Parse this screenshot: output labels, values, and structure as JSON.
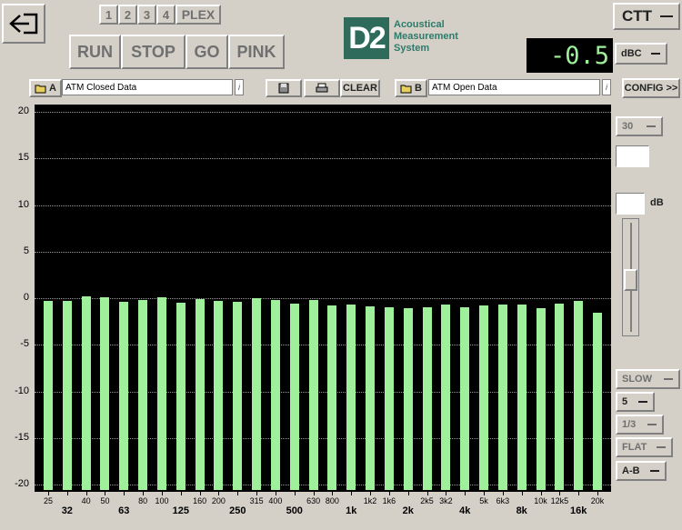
{
  "header": {
    "nums": [
      "1",
      "2",
      "3",
      "4"
    ],
    "plex": "PLEX",
    "run": "RUN",
    "stop": "STOP",
    "go": "GO",
    "pink": "PINK",
    "logo_mark": "D2",
    "logo_line1": "Acoustical",
    "logo_line2": "Measurement",
    "logo_line3": "System",
    "mode": "CTT",
    "readout": "-0.5",
    "weighting": "dBC",
    "config": "CONFIG >>"
  },
  "files": {
    "a_label": "A",
    "a_name": "ATM Closed Data",
    "b_label": "B",
    "b_name": "ATM Open Data",
    "info": "i",
    "clear": "CLEAR"
  },
  "side": {
    "range": "30",
    "db_label": "dB",
    "speed": "SLOW",
    "avg": "5",
    "bands": "1/3",
    "weight": "FLAT",
    "compare": "A-B"
  },
  "colors": {
    "bar": "#9ff09a",
    "plot_bg": "#000000",
    "readout": "#9ff09a"
  },
  "chart_data": {
    "type": "bar",
    "ylim": [
      -20,
      20
    ],
    "yticks": [
      20,
      15,
      10,
      5,
      0,
      -5,
      -10,
      -15,
      -20
    ],
    "categories": [
      "25",
      "32",
      "40",
      "50",
      "63",
      "80",
      "100",
      "125",
      "160",
      "200",
      "250",
      "315",
      "400",
      "500",
      "630",
      "800",
      "1k",
      "1k2",
      "1k6",
      "2k",
      "2k5",
      "3k2",
      "4k",
      "5k",
      "6k3",
      "8k",
      "10k",
      "12k5",
      "16k",
      "20k"
    ],
    "tick_labels": [
      "25",
      "40",
      "50",
      "80",
      "100",
      "160",
      "200",
      "315",
      "400",
      "630",
      "800",
      "1k2",
      "1k6",
      "2k5",
      "3k2",
      "5k",
      "6k3",
      "10k",
      "12k5",
      "20k"
    ],
    "major_labels": [
      "32",
      "63",
      "125",
      "250",
      "500",
      "1k",
      "2k",
      "4k",
      "8k",
      "16k"
    ],
    "values": [
      -0.3,
      -0.3,
      0.2,
      0.1,
      -0.4,
      -0.2,
      0.1,
      -0.5,
      -0.1,
      -0.3,
      -0.4,
      0.0,
      -0.2,
      -0.6,
      -0.2,
      -0.8,
      -0.7,
      -0.9,
      -1.0,
      -1.1,
      -1.0,
      -0.7,
      -1.0,
      -0.8,
      -0.7,
      -0.7,
      -1.1,
      -0.6,
      -0.3,
      -1.6
    ],
    "grid": true
  }
}
